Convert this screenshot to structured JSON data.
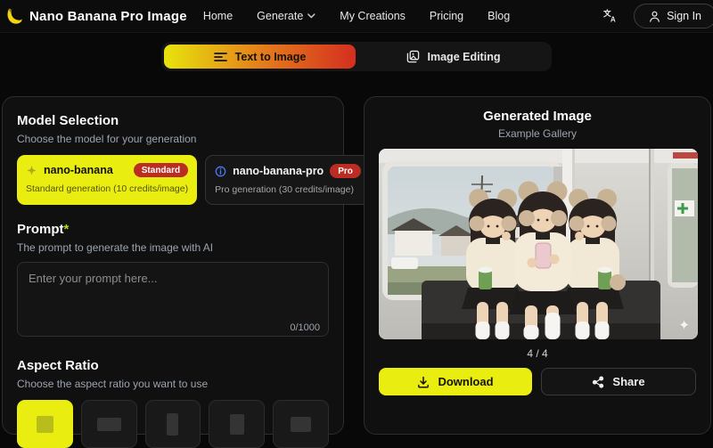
{
  "header": {
    "brand": "Nano Banana Pro Image",
    "nav": [
      {
        "label": "Home"
      },
      {
        "label": "Generate",
        "has_dropdown": true
      },
      {
        "label": "My Creations"
      },
      {
        "label": "Pricing"
      },
      {
        "label": "Blog"
      }
    ],
    "sign_in_label": "Sign In"
  },
  "mode_tabs": {
    "text_to_image": "Text to Image",
    "image_editing": "Image Editing",
    "active": "text_to_image"
  },
  "left_panel": {
    "model_section": {
      "title": "Model Selection",
      "subtitle": "Choose the model for your generation",
      "models": [
        {
          "name": "nano-banana",
          "badge": "Standard",
          "description": "Standard generation (10 credits/image)",
          "selected": true
        },
        {
          "name": "nano-banana-pro",
          "badge": "Pro",
          "description": "Pro generation (30 credits/image)",
          "selected": false
        }
      ]
    },
    "prompt_section": {
      "title": "Prompt",
      "required_marker": "*",
      "subtitle": "The prompt to generate the image with AI",
      "placeholder": "Enter your prompt here...",
      "value": "",
      "char_counter": "0/1000"
    },
    "aspect_section": {
      "title": "Aspect Ratio",
      "subtitle": "Choose the aspect ratio you want to use",
      "tiles": [
        {
          "shape": "1:1",
          "selected": true
        },
        {
          "shape": "16:9",
          "selected": false
        },
        {
          "shape": "9:16",
          "selected": false
        },
        {
          "shape": "3:4",
          "selected": false
        },
        {
          "shape": "4:3",
          "selected": false
        }
      ]
    }
  },
  "right_panel": {
    "title": "Generated Image",
    "subtitle": "Example Gallery",
    "image_alt": "three-girls-with-bear-earmuffs-on-train",
    "gallery_counter": "4 / 4",
    "download_label": "Download",
    "share_label": "Share"
  },
  "icons": {
    "logo": "banana-icon",
    "nav_dropdown": "chevron-down-icon",
    "language": "translate-icon",
    "sign_in": "user-icon",
    "text_to_image": "text-lines-icon",
    "image_editing": "image-edit-icon",
    "model_selected": "sparkles-icon",
    "model_pro": "info-icon",
    "download": "download-icon",
    "share": "share-icon",
    "photo_corner": "sparkle-icon"
  },
  "colors": {
    "accent_yellow": "#e9ee10",
    "gradient_start": "#e8e40c",
    "gradient_end": "#d32f1e",
    "badge_red": "#bb2d23",
    "info_blue": "#4a79f7",
    "panel_bg": "#101010",
    "panel_border": "#2d2d2d",
    "muted_text": "#9ca3af"
  }
}
